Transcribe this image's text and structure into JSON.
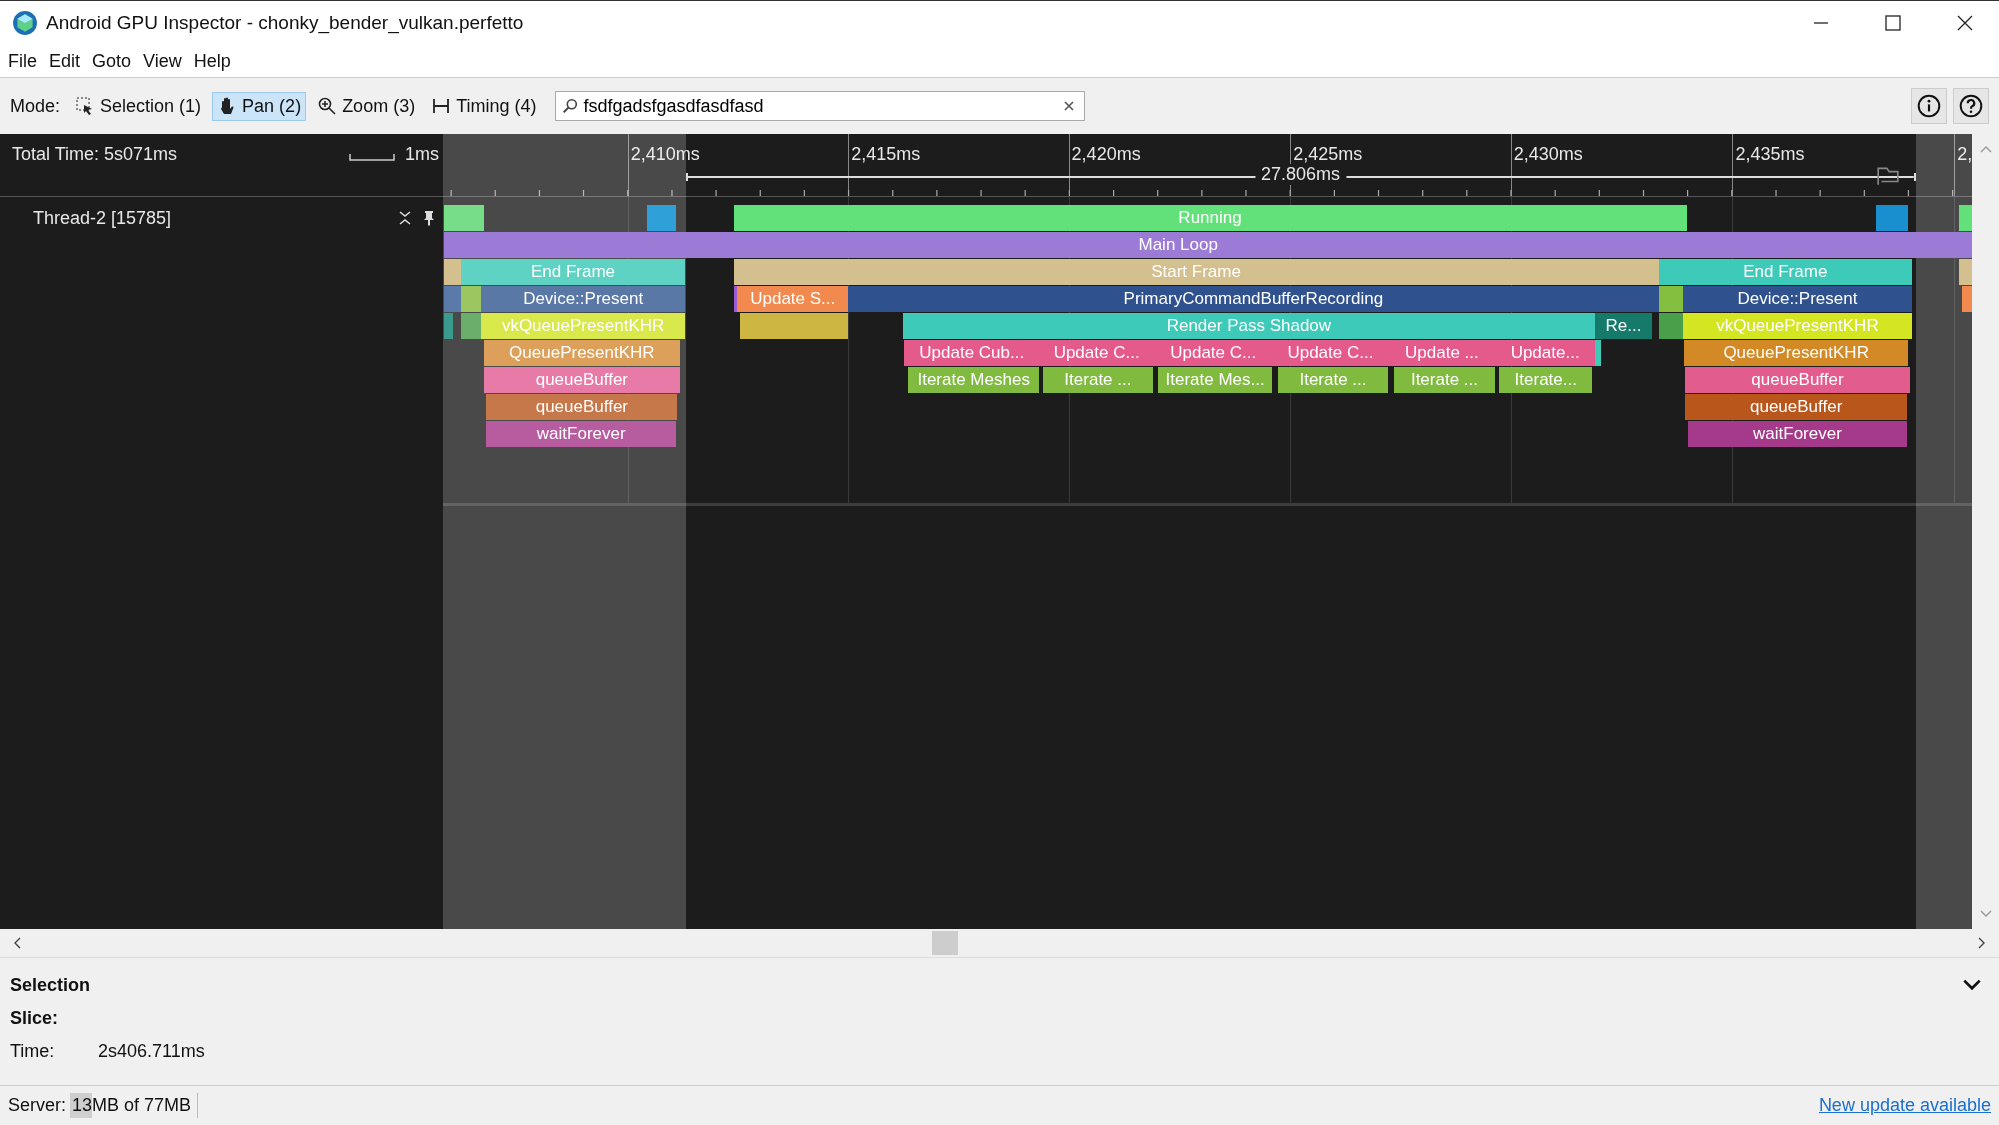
{
  "window": {
    "title": "Android GPU Inspector - chonky_bender_vulkan.perfetto"
  },
  "menu": [
    "File",
    "Edit",
    "Goto",
    "View",
    "Help"
  ],
  "toolbar": {
    "mode_label": "Mode:",
    "modes": [
      {
        "kind": "selection",
        "label": "Selection (1)",
        "selected": false
      },
      {
        "kind": "pan",
        "label": "Pan (2)",
        "selected": true
      },
      {
        "kind": "zoom",
        "label": "Zoom (3)",
        "selected": false
      },
      {
        "kind": "timing",
        "label": "Timing (4)",
        "selected": false
      }
    ],
    "search": {
      "value": "fsdfgadsfgasdfasdfasd"
    }
  },
  "timeline": {
    "total_time": "Total Time: 5s071ms",
    "scale_label": "1ms",
    "ticks": [
      "2,410ms",
      "2,415ms",
      "2,420ms",
      "2,425ms",
      "2,430ms",
      "2,435ms",
      "2,"
    ],
    "measurement": "27.806ms",
    "track": {
      "name": "Thread-2 [15785]",
      "rows": [
        {
          "slices": [
            {
              "color": "#77dd88"
            },
            {
              "color": "#2fa0d8"
            },
            {
              "label": "Running",
              "color": "#62e07a"
            },
            {
              "color": "#1a8fd0"
            },
            {
              "color": "#62e07a"
            }
          ]
        },
        {
          "slices": [
            {
              "label": "Main Loop",
              "color": "#9b7bd6"
            },
            {
              "color": "#9b7bd6"
            }
          ]
        },
        {
          "slices": [
            {
              "color": "#d4bf8f"
            },
            {
              "label": "End Frame",
              "color": "#5fd3c3"
            },
            {
              "label": "Start Frame",
              "color": "#d4bf8f"
            },
            {
              "label": "End Frame",
              "color": "#3ecab8"
            },
            {
              "color": "#d4bf8f"
            }
          ]
        },
        {
          "slices": [
            {
              "color": "#5a7aaa"
            },
            {
              "color": "#9cc65f"
            },
            {
              "label": "Device::Present",
              "color": "#5a78a6"
            },
            {
              "color": "#9b5bd6"
            },
            {
              "label": "Update S...",
              "color": "#f28a50"
            },
            {
              "label": "PrimaryCommandBufferRecording",
              "color": "#2f528e"
            },
            {
              "color": "#85bf40"
            },
            {
              "label": "Device::Present",
              "color": "#2f528e"
            },
            {
              "color": "#f28a50"
            }
          ]
        },
        {
          "slices": [
            {
              "color": "#3a9a8e"
            },
            {
              "color": "#6aae6a"
            },
            {
              "label": "vkQueuePresentKHR",
              "color": "#d9e84a"
            },
            {
              "color": "#cdb642"
            },
            {
              "label": "Render Pass Shadow",
              "color": "#3ecab8"
            },
            {
              "label": "Re...",
              "color": "#157a6a"
            },
            {
              "color": "#4aa04a"
            },
            {
              "label": "vkQueuePresentKHR",
              "color": "#d4e622"
            }
          ]
        },
        {
          "slices": [
            {
              "label": "QueuePresentKHR",
              "color": "#dca05a"
            },
            {
              "label": "Update Cub...",
              "color": "#e45a8a"
            },
            {
              "label": "Update C...",
              "color": "#e45a8a"
            },
            {
              "label": "Update C...",
              "color": "#e45a8a"
            },
            {
              "label": "Update C...",
              "color": "#e45a8a"
            },
            {
              "label": "Update ...",
              "color": "#e45a8a"
            },
            {
              "label": "Update...",
              "color": "#e45a8a"
            },
            {
              "color": "#3ecab8"
            },
            {
              "label": "QueuePresentKHR",
              "color": "#d38a26"
            }
          ]
        },
        {
          "slices": [
            {
              "label": "queueBuffer",
              "color": "#e87aa8"
            },
            {
              "label": "Iterate Meshes",
              "color": "#80bb40"
            },
            {
              "label": "Iterate ...",
              "color": "#80bb40"
            },
            {
              "label": "Iterate Mes...",
              "color": "#80bb40"
            },
            {
              "label": "Iterate ...",
              "color": "#80bb40"
            },
            {
              "label": "Iterate ...",
              "color": "#80bb40"
            },
            {
              "label": "Iterate...",
              "color": "#80bb40"
            },
            {
              "label": "queueBuffer",
              "color": "#e25c8e"
            }
          ]
        },
        {
          "slices": [
            {
              "label": "queueBuffer",
              "color": "#c6784a"
            },
            {
              "label": "queueBuffer",
              "color": "#b8561c"
            }
          ]
        },
        {
          "slices": [
            {
              "label": "waitForever",
              "color": "#b85ca0"
            },
            {
              "label": "waitForever",
              "color": "#a63a8a"
            }
          ]
        }
      ]
    }
  },
  "selection_panel": {
    "title": "Selection",
    "heading": "Slice:",
    "fields": [
      {
        "label": "Time:",
        "value": "2s406.711ms"
      }
    ]
  },
  "status_bar": {
    "server_label": "Server:",
    "memory": "13MB of 77MB",
    "level": 0.17,
    "update_link": "New update available"
  }
}
